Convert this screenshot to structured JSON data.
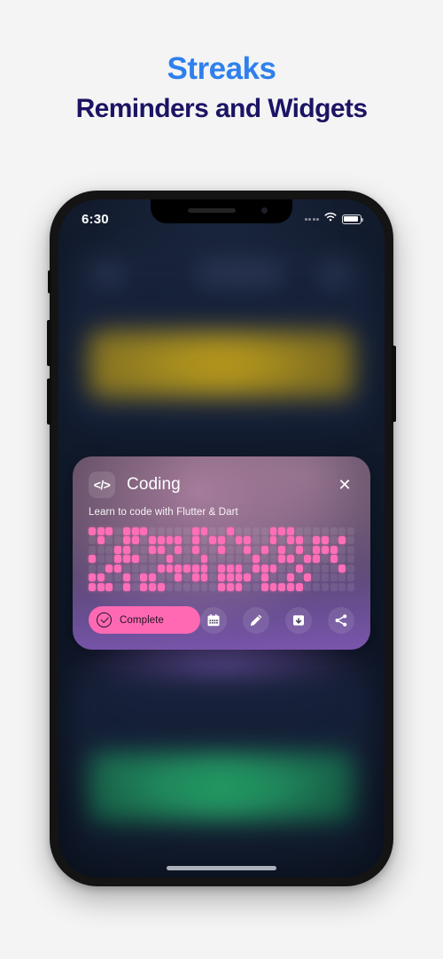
{
  "headline": {
    "line1": "Streaks",
    "line2": "Reminders and Widgets",
    "color_line1": "#2f80ed",
    "color_line2": "#1b1464"
  },
  "page": {
    "background": "#f4f4f4"
  },
  "phone": {
    "status_bar": {
      "time": "6:30",
      "signal_icon": "signal-dots-icon",
      "wifi_icon": "wifi-icon",
      "battery_icon": "battery-icon",
      "battery_level": "88"
    },
    "home_indicator": "home-indicator"
  },
  "card": {
    "icon": "code-brackets-icon",
    "icon_glyph": "</>",
    "title": "Coding",
    "subtitle": "Learn to code with Flutter & Dart",
    "close_icon": "close-icon",
    "close_glyph": "✕",
    "accent_color": "#ff69b4",
    "cell_on_color": "#ff6fb8",
    "cell_off_color": "rgba(255,255,255,0.085)"
  },
  "actions": {
    "complete_label": "Complete",
    "complete_icon": "check-circle-icon",
    "calendar_icon": "calendar-icon",
    "edit_icon": "pencil-icon",
    "archive_icon": "archive-icon",
    "share_icon": "share-icon"
  },
  "streak_grid": {
    "columns": 31,
    "rows": 7,
    "cells": [
      [
        1,
        1,
        1,
        0,
        1,
        1,
        1,
        0,
        0,
        0,
        0,
        0,
        1,
        1,
        0,
        0,
        1,
        0,
        0,
        0,
        0,
        1,
        1,
        1,
        0,
        0,
        0,
        0,
        0,
        0,
        0
      ],
      [
        0,
        1,
        0,
        0,
        1,
        1,
        0,
        1,
        1,
        1,
        1,
        0,
        1,
        0,
        1,
        1,
        0,
        1,
        1,
        0,
        0,
        1,
        0,
        1,
        1,
        0,
        1,
        1,
        0,
        1,
        0
      ],
      [
        0,
        0,
        0,
        1,
        1,
        0,
        0,
        1,
        1,
        0,
        1,
        0,
        1,
        0,
        0,
        1,
        0,
        0,
        1,
        0,
        1,
        0,
        1,
        0,
        1,
        0,
        1,
        1,
        1,
        0,
        0
      ],
      [
        1,
        0,
        0,
        1,
        1,
        1,
        0,
        0,
        0,
        1,
        0,
        0,
        0,
        1,
        0,
        0,
        0,
        0,
        0,
        1,
        0,
        0,
        1,
        1,
        0,
        1,
        1,
        0,
        1,
        0,
        0
      ],
      [
        0,
        0,
        1,
        1,
        0,
        0,
        0,
        0,
        1,
        1,
        1,
        1,
        1,
        1,
        0,
        1,
        1,
        1,
        0,
        1,
        1,
        1,
        0,
        0,
        1,
        0,
        0,
        0,
        0,
        1,
        0
      ],
      [
        1,
        1,
        0,
        0,
        1,
        0,
        1,
        1,
        0,
        0,
        1,
        0,
        1,
        1,
        0,
        1,
        1,
        1,
        1,
        0,
        1,
        0,
        0,
        1,
        0,
        1,
        0,
        0,
        0,
        0,
        0
      ],
      [
        1,
        1,
        1,
        0,
        1,
        0,
        1,
        1,
        1,
        0,
        0,
        0,
        0,
        0,
        0,
        1,
        1,
        1,
        0,
        0,
        1,
        1,
        1,
        1,
        1,
        0,
        0,
        0,
        0,
        0,
        0
      ]
    ]
  }
}
